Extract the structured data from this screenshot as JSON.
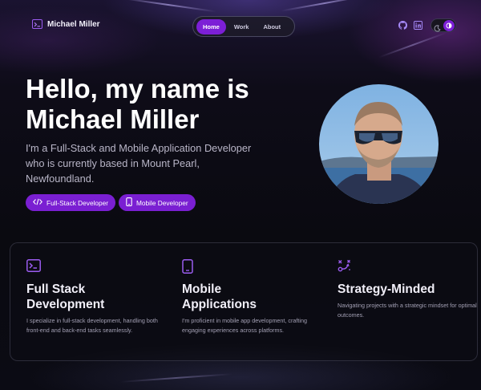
{
  "header": {
    "brand_name": "Michael Miller",
    "brand_icon": "terminal-icon",
    "nav": [
      {
        "label": "Home",
        "active": true
      },
      {
        "label": "Work",
        "active": false
      },
      {
        "label": "About",
        "active": false
      }
    ],
    "socials": [
      "github-icon",
      "linkedin-icon"
    ],
    "theme_toggle": {
      "left_icon": "moon-icon",
      "right_icon": "theme-icon",
      "state": "on"
    }
  },
  "hero": {
    "title": "Hello, my name is\nMichael Miller",
    "subtitle": "I'm a Full-Stack and Mobile Application Developer who is currently based in Mount Pearl, Newfoundland.",
    "chips": [
      {
        "label": "Full-Stack Developer",
        "icon": "code-icon"
      },
      {
        "label": "Mobile Developer",
        "icon": "phone-icon"
      }
    ],
    "avatar_icon": "profile-photo"
  },
  "features": [
    {
      "icon": "terminal-icon",
      "title": "Full Stack\nDevelopment",
      "description": "I specialize in full-stack development, handling both front-end and back-end tasks seamlessly."
    },
    {
      "icon": "phone-icon",
      "title": "Mobile\nApplications",
      "description": "I'm proficient in mobile app development, crafting engaging experiences across platforms."
    },
    {
      "icon": "strategy-icon",
      "title": "Strategy-Minded",
      "description": "Navigating projects with a strategic mindset for optimal outcomes."
    }
  ],
  "colors": {
    "accent": "#7c1fd6",
    "accent_light": "#9b5cf0",
    "background": "#0b0a12",
    "text": "#ffffff",
    "muted": "#b9b6c8"
  }
}
